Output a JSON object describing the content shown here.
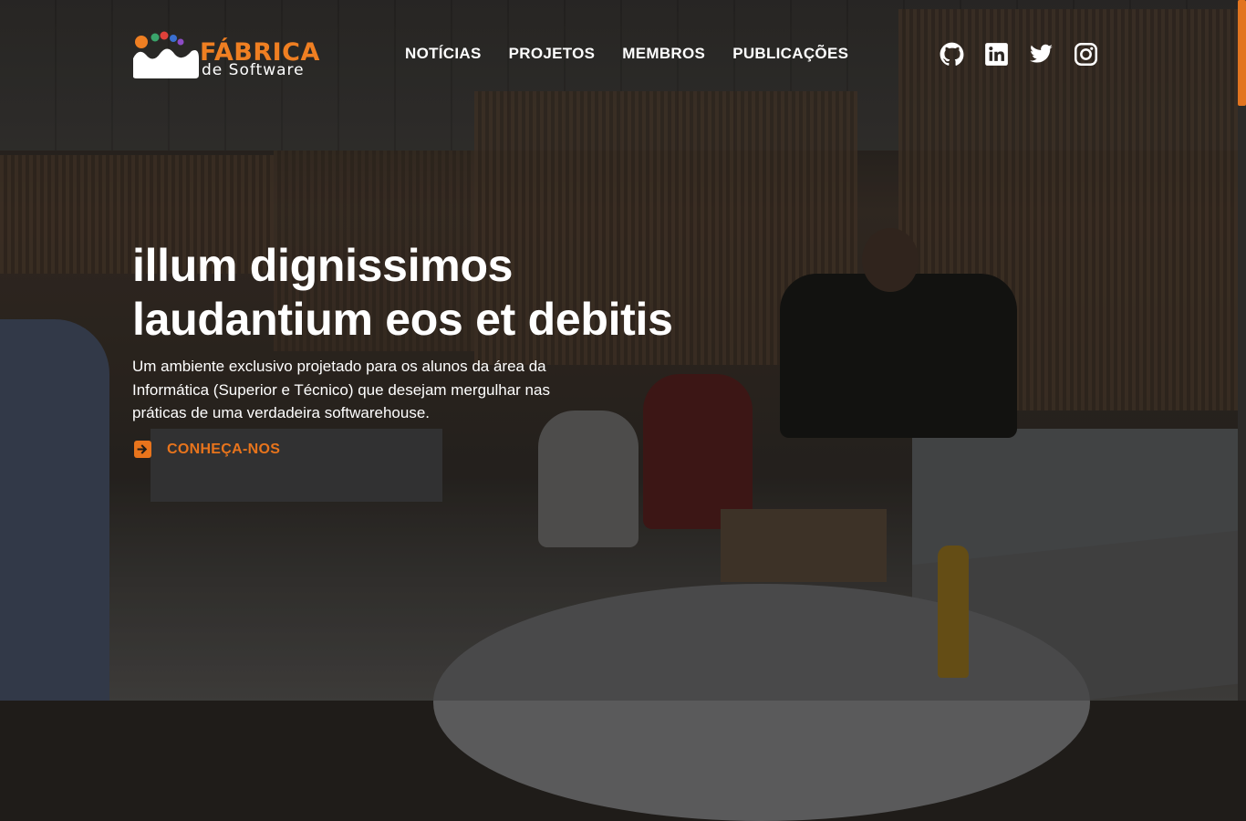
{
  "brand": {
    "title": "FÁBRICA",
    "subtitle": "de Software",
    "accent_color": "#e8741c"
  },
  "nav": {
    "items": [
      {
        "label": "NOTÍCIAS"
      },
      {
        "label": "PROJETOS"
      },
      {
        "label": "MEMBROS"
      },
      {
        "label": "PUBLICAÇÕES"
      }
    ]
  },
  "social": {
    "icons": [
      "github-icon",
      "linkedin-icon",
      "twitter-icon",
      "instagram-icon"
    ]
  },
  "hero": {
    "title_line1": "illum dignissimos",
    "title_line2_plain": "laudantium eos ",
    "title_line2_highlight": "et debitis",
    "description": "Um ambiente exclusivo projetado para os alunos da área da Informática (Superior e Técnico) que desejam mergulhar nas práticas de uma verdadeira softwarehouse.",
    "cta_label": "CONHEÇA-NOS",
    "cta_icon": "arrow-right-square-icon"
  }
}
